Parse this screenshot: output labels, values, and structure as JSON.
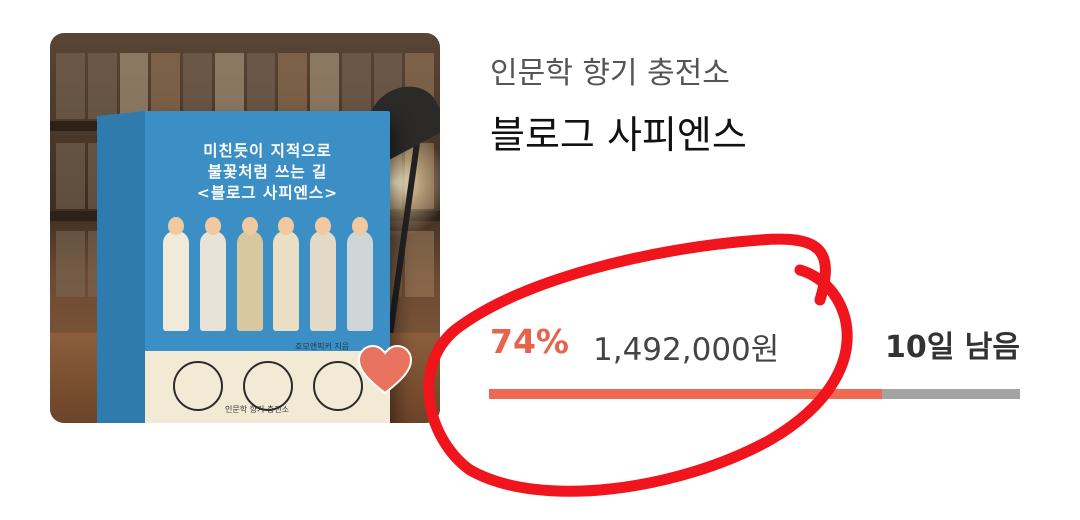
{
  "funding": {
    "category": "인문학 향기 충전소",
    "title": "블로그 사피엔스",
    "percent_label": "74%",
    "progress_fraction": 0.74,
    "amount": "1,492,000원",
    "days_left": "10일 남음"
  },
  "book_cover": {
    "title_lines": [
      "미친듯이 지적으로",
      "불꽃처럼 쓰는 길",
      "<블로그 사피엔스>"
    ],
    "author": "호모앤픽커 지음",
    "publisher": "인문학 향기 충전소"
  },
  "colors": {
    "accent": "#ee6a52",
    "percent_text": "#e8634e",
    "track": "#a3a3a3",
    "heart": "#e8735f",
    "annotation_circle": "#f0141c"
  },
  "icons": {
    "wishlist": "heart-icon"
  }
}
